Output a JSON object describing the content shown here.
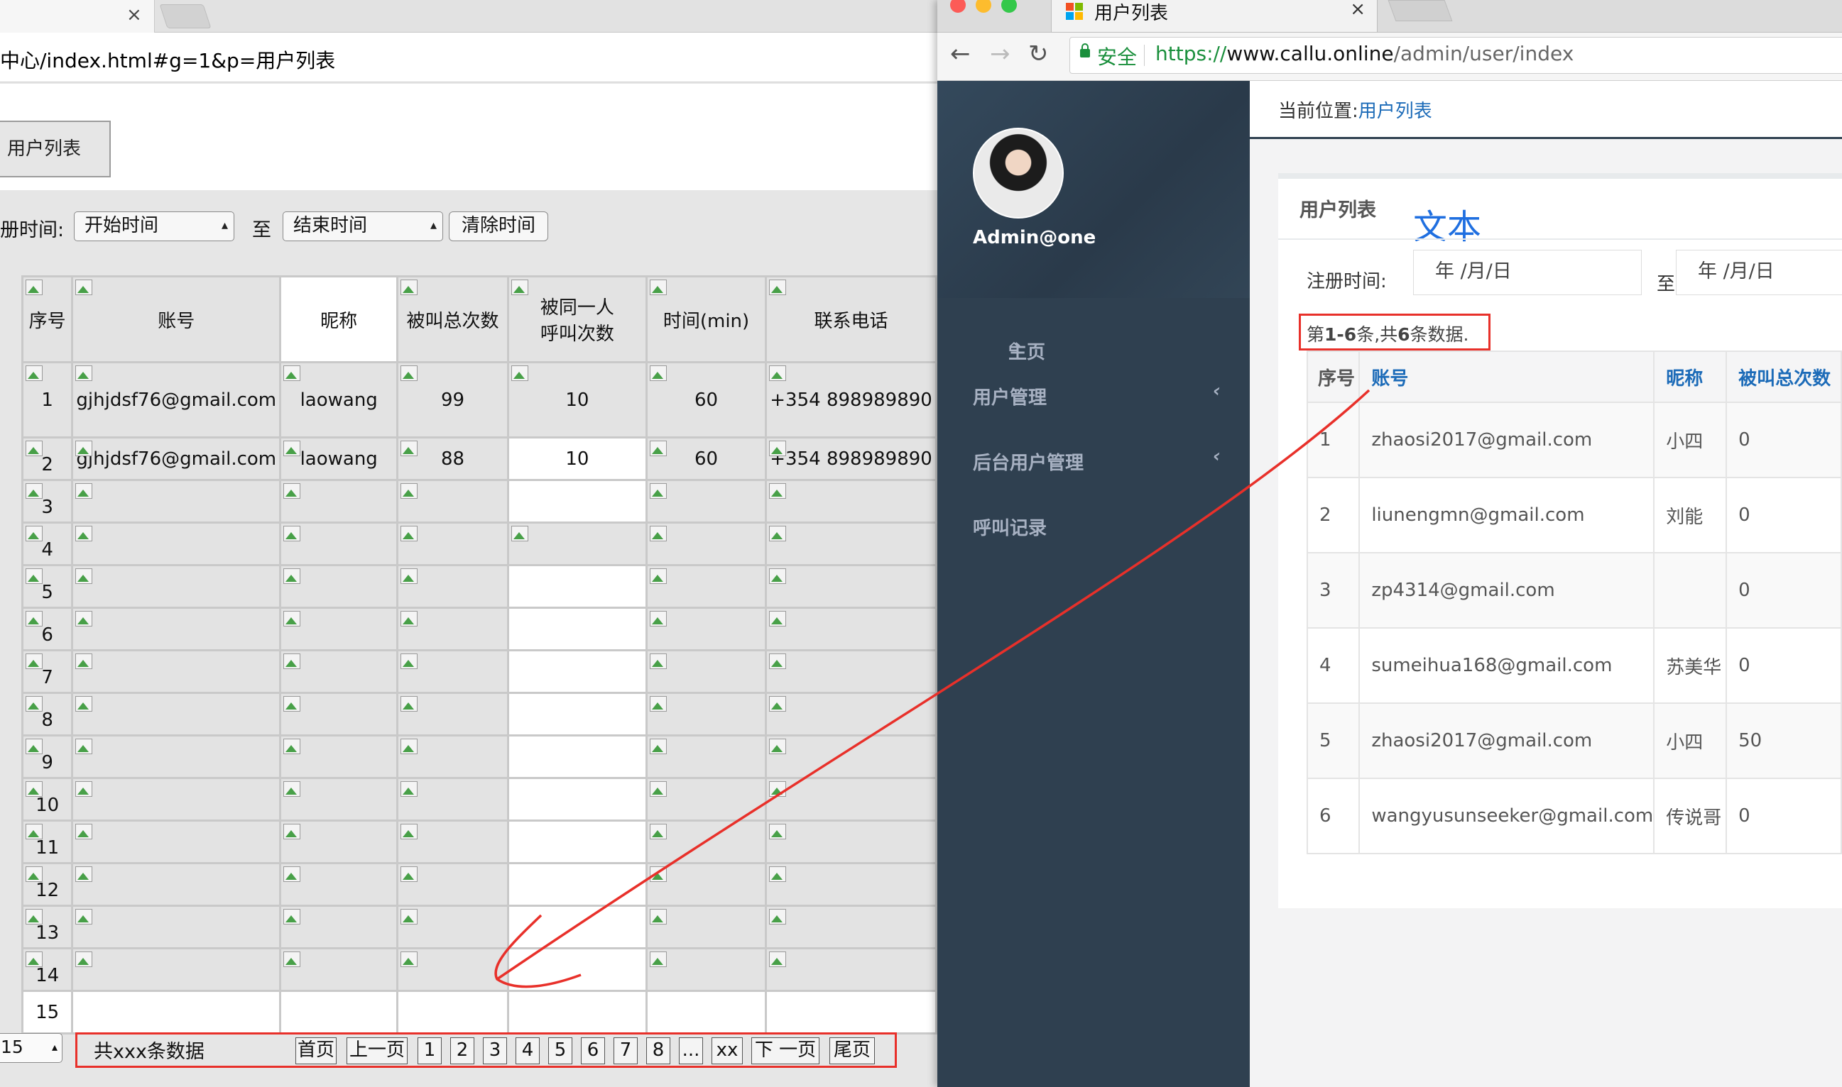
{
  "left": {
    "address": "中心/index.html#g=1&p=用户列表",
    "list_button": "用户列表",
    "filter": {
      "label": "册时间:",
      "start": "开始时间",
      "to": "至",
      "end": "结束时间",
      "clear": "清除时间"
    },
    "columns": [
      "序号",
      "账号",
      "昵称",
      "被叫总次数",
      "被同一人\n呼叫次数",
      "时间(min)",
      "联系电话"
    ],
    "rows": [
      [
        "1",
        "gjhjdsf76@gmail.com",
        "laowang",
        "99",
        "10",
        "60",
        "+354 898989890"
      ],
      [
        "2",
        "gjhjdsf76@gmail.com",
        "laowang",
        "88",
        "10",
        "60",
        "+354 898989890"
      ],
      [
        "3",
        "",
        "",
        "",
        "",
        "",
        ""
      ],
      [
        "4",
        "",
        "",
        "",
        "",
        "",
        ""
      ],
      [
        "5",
        "",
        "",
        "",
        "",
        "",
        ""
      ],
      [
        "6",
        "",
        "",
        "",
        "",
        "",
        ""
      ],
      [
        "7",
        "",
        "",
        "",
        "",
        "",
        ""
      ],
      [
        "8",
        "",
        "",
        "",
        "",
        "",
        ""
      ],
      [
        "9",
        "",
        "",
        "",
        "",
        "",
        ""
      ],
      [
        "10",
        "",
        "",
        "",
        "",
        "",
        ""
      ],
      [
        "11",
        "",
        "",
        "",
        "",
        "",
        ""
      ],
      [
        "12",
        "",
        "",
        "",
        "",
        "",
        ""
      ],
      [
        "13",
        "",
        "",
        "",
        "",
        "",
        ""
      ],
      [
        "14",
        "",
        "",
        "",
        "",
        "",
        ""
      ],
      [
        "15",
        "",
        "",
        "",
        "",
        "",
        ""
      ]
    ],
    "page_size": "15",
    "pagination": {
      "total": "共xxx条数据",
      "first": "首页",
      "prev": "上一页",
      "pages": [
        "1",
        "2",
        "3",
        "4",
        "5",
        "6",
        "7",
        "8",
        "...",
        "xx"
      ],
      "next": "下 一页",
      "last": "尾页"
    }
  },
  "right": {
    "tab_title": "用户列表",
    "secure": "安全",
    "url_scheme": "https://",
    "url_host": "www.callu.online",
    "url_path": "/admin/user/index",
    "username": "Admin@one",
    "menu": [
      {
        "label": "主页",
        "icon": "home-icon",
        "chevron": false
      },
      {
        "label": "用户管理",
        "chevron": true
      },
      {
        "label": "后台用户管理",
        "chevron": true
      },
      {
        "label": "呼叫记录",
        "chevron": false
      }
    ],
    "breadcrumb_label": "当前位置:",
    "breadcrumb_current": "用户列表",
    "panel_title": "用户列表",
    "note": "文本",
    "reg_label": "注册时间:",
    "date_placeholder": "年 /月/日",
    "to": "至",
    "summary_prefix": "第",
    "summary_range": "1-6",
    "summary_mid": "条,共",
    "summary_count": "6",
    "summary_suffix": "条数据.",
    "columns": [
      "序号",
      "账号",
      "昵称",
      "被叫总次数"
    ],
    "rows": [
      [
        "1",
        "zhaosi2017@gmail.com",
        "小四",
        "0"
      ],
      [
        "2",
        "liunengmn@gmail.com",
        "刘能",
        "0"
      ],
      [
        "3",
        "zp4314@gmail.com",
        "",
        "0"
      ],
      [
        "4",
        "sumeihua168@gmail.com",
        "苏美华",
        "0"
      ],
      [
        "5",
        "zhaosi2017@gmail.com",
        "小四",
        "50"
      ],
      [
        "6",
        "wangyusunseeker@gmail.com",
        "传说哥",
        "0"
      ]
    ]
  },
  "colors": {
    "annotation_red": "#e8302a",
    "sidebar": "#2f4050",
    "link_blue": "#1c6bb8",
    "note_blue": "#1f6fe0"
  }
}
